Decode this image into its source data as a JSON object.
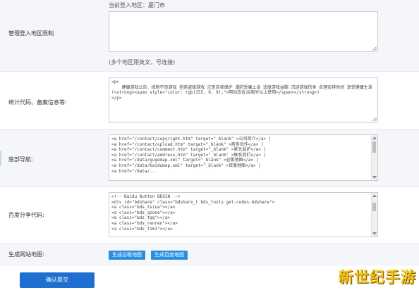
{
  "region": {
    "label": "管理登入地区限制",
    "current": "当前登入地区：厦门市",
    "value": "",
    "hint": "(多个地区用英文，号连接)"
  },
  "stats": {
    "label": "统计代码、备案信息等:",
    "value": "<p>\n    健康游戏公告：抵制不良游戏 拒绝盗版游戏 注意自我保护 谨防受骗上当 适度游戏益脑 沉迷游戏伤身 合理安排时间 享受健康生活(<strong><span style=\"color: rgb(255, 0, 0);\">网站适合18周岁以上使用</span></strong>)\n</p>"
  },
  "footer_nav": {
    "label": "底部导航:",
    "value": "<a href=\"/contact/copyright.htm\" target=\"_blank\" >公司简介</a> |\n<a href=\"/contact/upload.htm\" target=\"_blank\" >商务合作</a> |\n<a href=\"/contact/comment.htm\" target=\"_blank\" >家长监护</a> |\n<a href=\"/contact/address.htm\" target=\"_blank\" >联系我们</a> |\n<a href=\"/data/gugemap.xml\" target=\"_blank\" >谷歌地图</a> |\n<a href=\"/data/baidumap.xml\" target=\"_blank\" >百度地图</a> |\n<a href=\"/data/..."
  },
  "baidu_share": {
    "label": "百度分享代码:",
    "value": "<!-- Baidu Button BEGIN -->\n<div id=\"bdshare\" class=\"bdshare_t bds_tools get-codes-bdshare\">\n<a class=\"bds_tsina\"></a>\n<a class=\"bds_qzone\"></a>\n<a class=\"bds_tqq\"></a>\n<a class=\"bds_renren\"></a>\n<a class=\"bds_t163\"></a>"
  },
  "sitemap": {
    "label": "生成网站地图:",
    "google_btn": "生成谷歌地图",
    "baidu_btn": "生成百度地图"
  },
  "confirm_btn": "确认提交",
  "watermark": "新世纪手游"
}
